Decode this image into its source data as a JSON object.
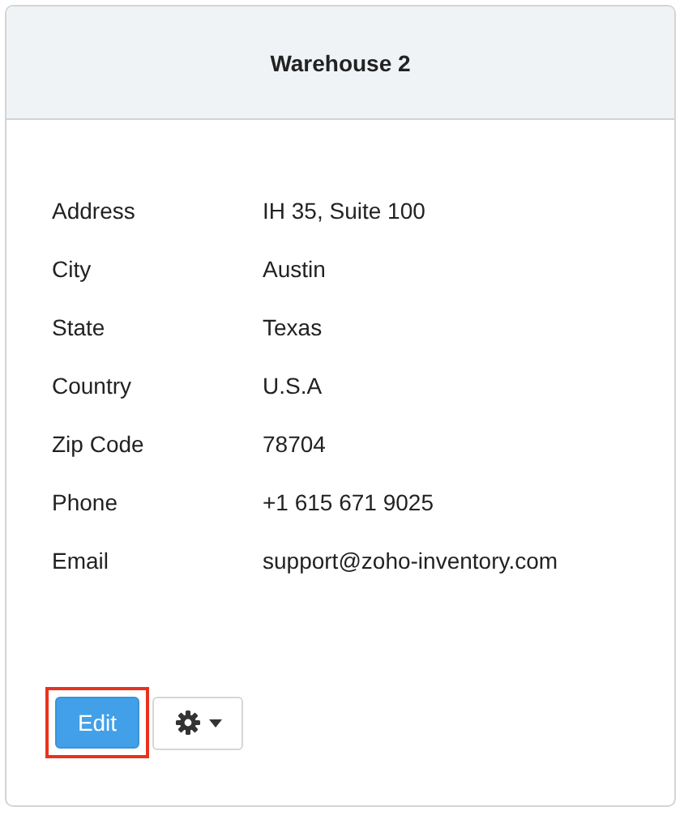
{
  "header": {
    "title": "Warehouse 2"
  },
  "fields": [
    {
      "label": "Address",
      "value": "IH 35, Suite 100"
    },
    {
      "label": "City",
      "value": "Austin"
    },
    {
      "label": "State",
      "value": "Texas"
    },
    {
      "label": "Country",
      "value": "U.S.A"
    },
    {
      "label": "Zip Code",
      "value": "78704"
    },
    {
      "label": "Phone",
      "value": "+1 615 671 9025"
    },
    {
      "label": "Email",
      "value": "support@zoho-inventory.com"
    }
  ],
  "actions": {
    "edit": {
      "label": "Edit",
      "highlighted": true
    }
  }
}
